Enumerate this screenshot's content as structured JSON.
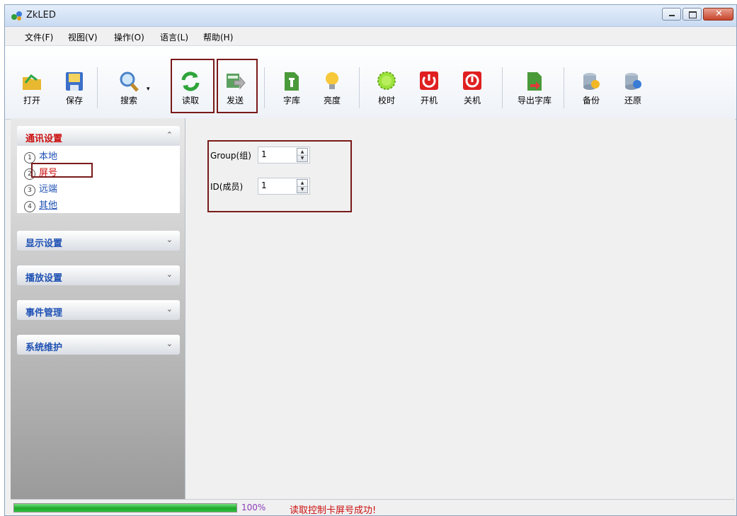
{
  "window": {
    "title": "ZkLED"
  },
  "menu": [
    "文件(F)",
    "视图(V)",
    "操作(O)",
    "语言(L)",
    "帮助(H)"
  ],
  "toolbar": [
    {
      "label": "打开",
      "icon": "open-folder-icon"
    },
    {
      "label": "保存",
      "icon": "save-icon"
    },
    {
      "label": "搜索",
      "icon": "search-icon"
    },
    {
      "label": "读取",
      "icon": "refresh-icon"
    },
    {
      "label": "发送",
      "icon": "send-icon"
    },
    {
      "label": "字库",
      "icon": "font-library-icon"
    },
    {
      "label": "亮度",
      "icon": "brightness-bulb-icon"
    },
    {
      "label": "校时",
      "icon": "time-sync-icon"
    },
    {
      "label": "开机",
      "icon": "power-on-icon"
    },
    {
      "label": "关机",
      "icon": "power-off-icon"
    },
    {
      "label": "导出字库",
      "icon": "export-font-icon"
    },
    {
      "label": "备份",
      "icon": "backup-icon"
    },
    {
      "label": "还原",
      "icon": "restore-icon"
    }
  ],
  "sidebar": {
    "groups": [
      {
        "title": "通讯设置",
        "expanded": true,
        "items": [
          {
            "num": "1",
            "label": "本地"
          },
          {
            "num": "2",
            "label": "屏号"
          },
          {
            "num": "3",
            "label": "远端"
          },
          {
            "num": "4",
            "label": "其他"
          }
        ]
      },
      {
        "title": "显示设置",
        "expanded": false
      },
      {
        "title": "播放设置",
        "expanded": false
      },
      {
        "title": "事件管理",
        "expanded": false
      },
      {
        "title": "系统维护",
        "expanded": false
      }
    ]
  },
  "form": {
    "group_label": "Group(组)",
    "group_value": "1",
    "id_label": "ID(成员)",
    "id_value": "1"
  },
  "status": {
    "progress_percent": 100,
    "percent_text": "100%",
    "message": "读取控制卡屏号成功!"
  },
  "colors": {
    "accent": "#1e50b4",
    "active": "#cc1010",
    "highlight_box": "#7a1a1a"
  }
}
